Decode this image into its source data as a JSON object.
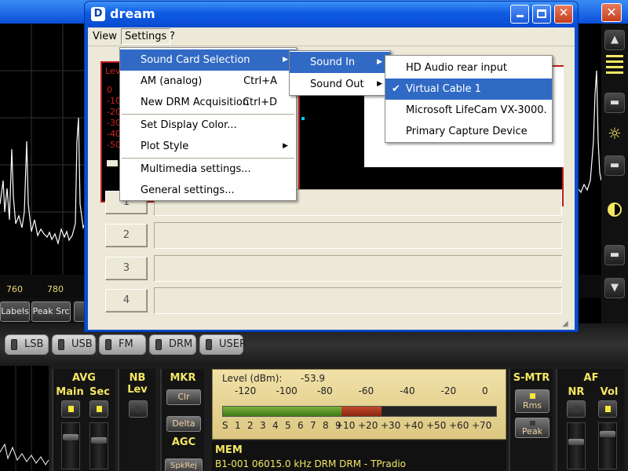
{
  "dream_window": {
    "title": "dream",
    "icon_letter": "D",
    "menubar": [
      "View",
      "Settings",
      "?"
    ],
    "service_buttons": [
      "1",
      "2",
      "3",
      "4"
    ]
  },
  "settings_menu": {
    "items": [
      {
        "label": "Sound Card Selection",
        "shortcut": "",
        "submenu": true
      },
      {
        "label": "AM (analog)",
        "shortcut": "Ctrl+A",
        "submenu": false
      },
      {
        "label": "New DRM Acquisition",
        "shortcut": "Ctrl+D",
        "submenu": false
      },
      {
        "label": "Set Display Color...",
        "shortcut": "",
        "submenu": false
      },
      {
        "label": "Plot Style",
        "shortcut": "",
        "submenu": true
      },
      {
        "label": "Multimedia settings...",
        "shortcut": "",
        "submenu": false
      },
      {
        "label": "General settings...",
        "shortcut": "",
        "submenu": false
      }
    ]
  },
  "soundcard_menu": {
    "items": [
      {
        "label": "Sound In"
      },
      {
        "label": "Sound Out"
      }
    ]
  },
  "soundin_menu": {
    "items": [
      {
        "label": "HD Audio rear input",
        "checked": false
      },
      {
        "label": "Virtual Cable 1",
        "checked": true
      },
      {
        "label": "Microsoft LifeCam VX-3000.",
        "checked": false
      },
      {
        "label": "Primary Capture Device",
        "checked": false
      }
    ]
  },
  "level_panel": {
    "title": "Lev",
    "ticks": [
      "0",
      "-10",
      "-20",
      "-30",
      "-40",
      "-50"
    ]
  },
  "background_app": {
    "freq_ticks": [
      "760",
      "780"
    ],
    "left_buttons": [
      "Labels",
      "Peak Src"
    ],
    "modes": [
      "LSB",
      "USB",
      "FM",
      "DRM",
      "USER"
    ],
    "avg": {
      "title": "AVG",
      "main": "Main",
      "sec": "Sec"
    },
    "nb": {
      "title": "NB",
      "lev": "Lev"
    },
    "mkr": {
      "title": "MKR",
      "clr": "Clr",
      "delta": "Delta"
    },
    "agc": {
      "title": "AGC",
      "spkrej": "SpkRej"
    },
    "smtr": {
      "title": "S-MTR",
      "rms": "Rms",
      "peak": "Peak"
    },
    "af": {
      "title": "AF",
      "nr": "NR",
      "vol": "Vol"
    },
    "level_meter": {
      "label": "Level (dBm):",
      "value": "-53.9",
      "top_scale": [
        "-120",
        "-100",
        "-80",
        "-60",
        "-40",
        "-20",
        "0"
      ],
      "bottom_scale": [
        "S",
        "1",
        "2",
        "3",
        "4",
        "5",
        "6",
        "7",
        "8",
        "9",
        "+10",
        "+20",
        "+30",
        "+40",
        "+50",
        "+60",
        "+70"
      ],
      "green_fraction": 0.435,
      "red_fraction": 0.145
    },
    "mem": {
      "title": "MEM",
      "text": "B1-001 06015.0 kHz DRM  DRM - TPradio"
    }
  },
  "colors": {
    "xp_blue": "#0a4ed0",
    "menu_highlight": "#316ac5",
    "meter_yellow": "#f5e663",
    "level_red": "#c41c1c"
  }
}
